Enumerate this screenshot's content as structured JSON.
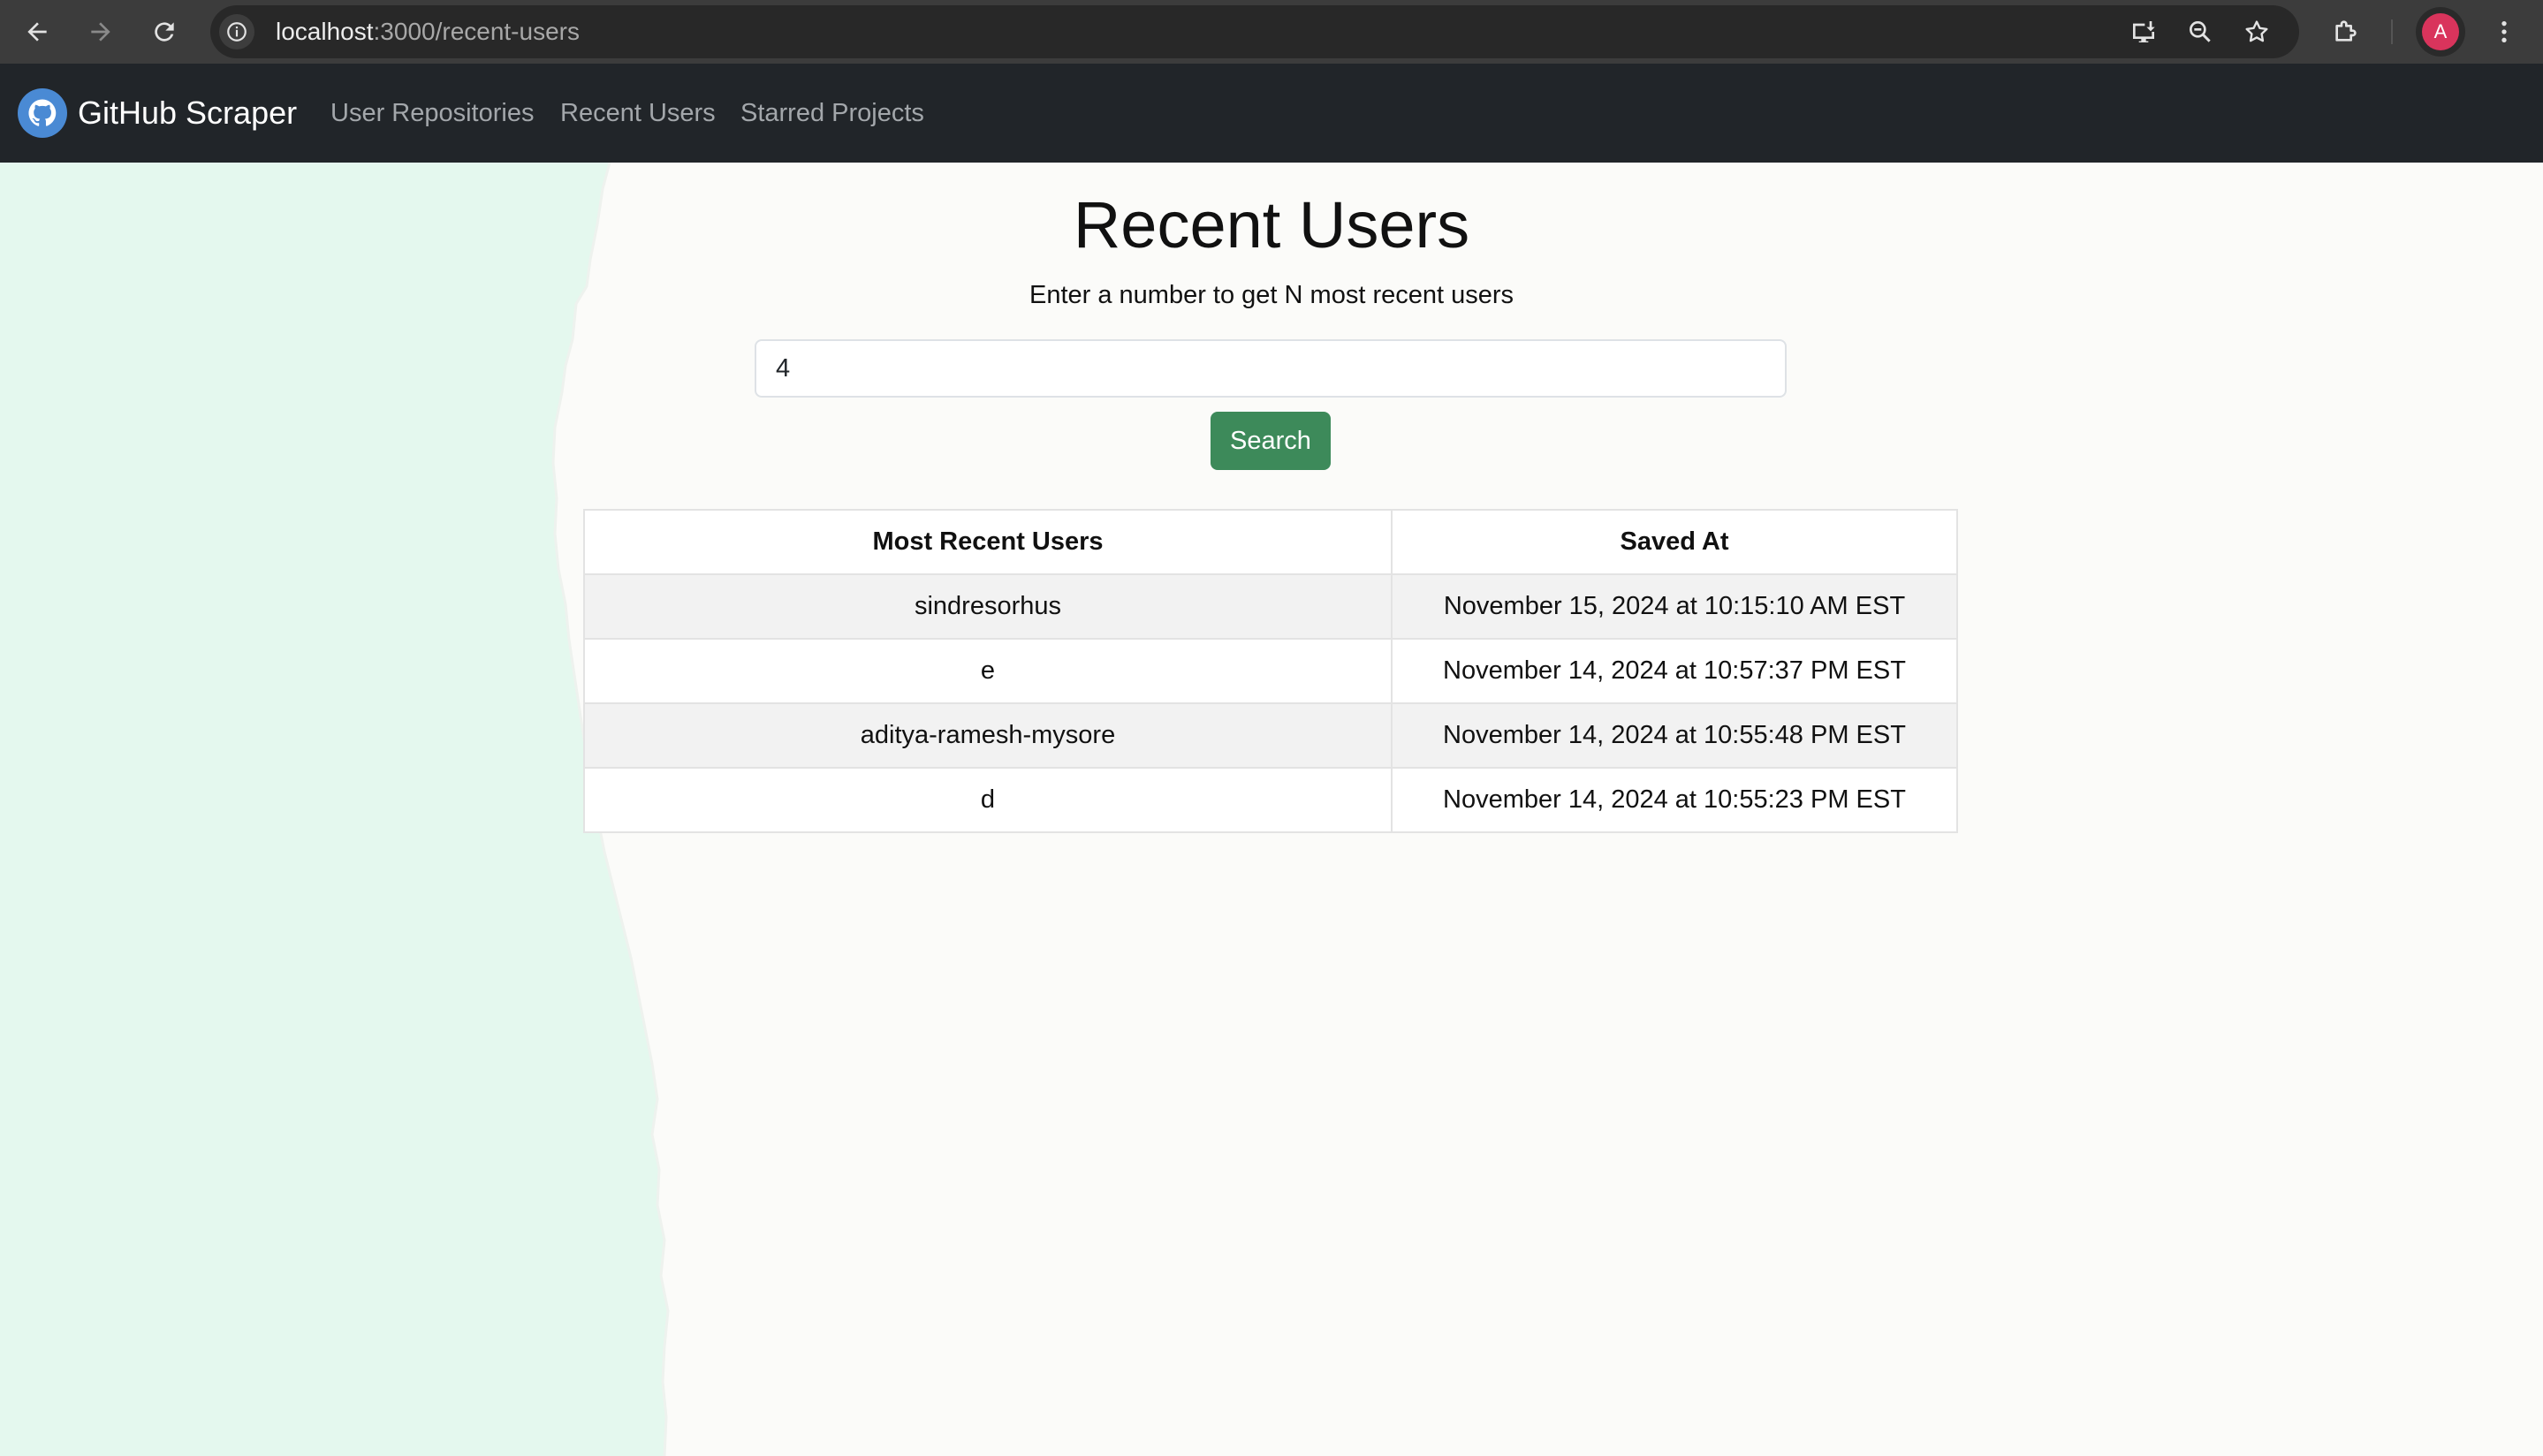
{
  "browser": {
    "url_host": "localhost",
    "url_path": ":3000/recent-users",
    "profile_initial": "A",
    "colors": {
      "bar": "#3c3c3c",
      "url_box": "#282828",
      "avatar": "#d9345c"
    }
  },
  "navbar": {
    "brand": "GitHub Scraper",
    "links": [
      "User Repositories",
      "Recent Users",
      "Starred Projects"
    ],
    "colors": {
      "background": "#212529",
      "link": "#a3a7ab"
    }
  },
  "main": {
    "title": "Recent Users",
    "subtitle": "Enter a number to get N most recent users",
    "input_value": "4",
    "search_label": "Search",
    "colors": {
      "search_button": "#3d8a5a",
      "torn_paper": "#e4f8ee"
    }
  },
  "table": {
    "headers": [
      "Most Recent Users",
      "Saved At"
    ],
    "rows": [
      {
        "user": "sindresorhus",
        "saved_at": "November 15, 2024 at 10:15:10 AM EST"
      },
      {
        "user": "e",
        "saved_at": "November 14, 2024 at 10:57:37 PM EST"
      },
      {
        "user": "aditya-ramesh-mysore",
        "saved_at": "November 14, 2024 at 10:55:48 PM EST"
      },
      {
        "user": "d",
        "saved_at": "November 14, 2024 at 10:55:23 PM EST"
      }
    ]
  }
}
